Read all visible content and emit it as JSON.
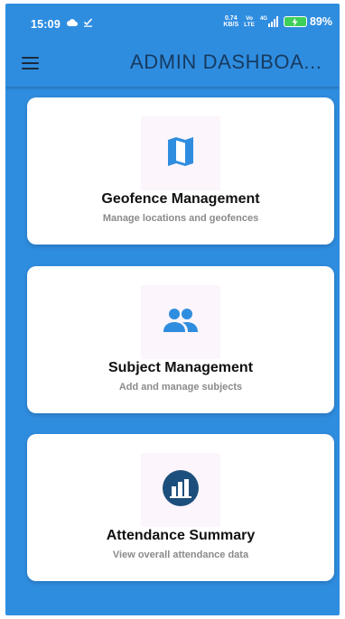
{
  "status_bar": {
    "time": "15:09",
    "speed_value": "0.74",
    "speed_unit": "KB/S",
    "network_top": "Vo",
    "network_bottom": "LTE",
    "signal_label": "4G",
    "battery": "89%"
  },
  "app_bar": {
    "title": "ADMIN DASHBOA..."
  },
  "cards": [
    {
      "title": "Geofence Management",
      "subtitle": "Manage locations and geofences",
      "icon": "map-icon"
    },
    {
      "title": "Subject Management",
      "subtitle": "Add and manage subjects",
      "icon": "people-icon"
    },
    {
      "title": "Attendance Summary",
      "subtitle": "View overall attendance data",
      "icon": "bar-chart-icon"
    }
  ],
  "colors": {
    "primary": "#2f8de0",
    "title_text": "#163a5f",
    "card_bg": "#ffffff",
    "icon_blue": "#2f8de0",
    "icon_dark": "#1d4f7c"
  }
}
